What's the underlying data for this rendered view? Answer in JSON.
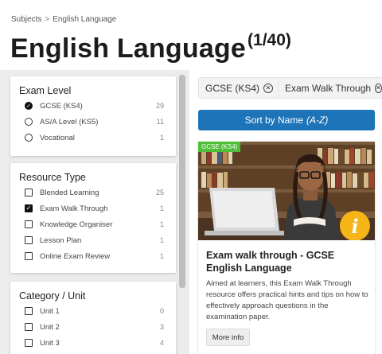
{
  "breadcrumb": {
    "root": "Subjects",
    "separator": ">",
    "current": "English Language"
  },
  "page": {
    "title": "English Language",
    "count": "(1/40)"
  },
  "filters": {
    "exam_level": {
      "title": "Exam Level",
      "options": [
        {
          "label": "GCSE (KS4)",
          "count": "29",
          "checked": true
        },
        {
          "label": "AS/A Level (KS5)",
          "count": "11",
          "checked": false
        },
        {
          "label": "Vocational",
          "count": "1",
          "checked": false
        }
      ]
    },
    "resource_type": {
      "title": "Resource Type",
      "options": [
        {
          "label": "Blended Learning",
          "count": "25",
          "checked": false
        },
        {
          "label": "Exam Walk Through",
          "count": "1",
          "checked": true
        },
        {
          "label": "Knowledge Organiser",
          "count": "1",
          "checked": false
        },
        {
          "label": "Lesson Plan",
          "count": "1",
          "checked": false
        },
        {
          "label": "Online Exam Review",
          "count": "1",
          "checked": false
        }
      ]
    },
    "category": {
      "title": "Category / Unit",
      "options": [
        {
          "label": "Unit 1",
          "count": "0",
          "checked": false
        },
        {
          "label": "Unit 2",
          "count": "3",
          "checked": false
        },
        {
          "label": "Unit 3",
          "count": "4",
          "checked": false
        }
      ]
    }
  },
  "chips": [
    {
      "label": "GCSE (KS4)"
    },
    {
      "label": "Exam Walk Through"
    }
  ],
  "sort": {
    "label": "Sort by Name",
    "order": "(A-Z)"
  },
  "card": {
    "tag": "GCSE (KS4)",
    "title": "Exam walk through - GCSE English Language",
    "description": "Aimed at learners, this Exam Walk Through resource offers practical hints and tips on how to effectively approach questions in the examination paper.",
    "button": "More info",
    "badge": "i"
  },
  "colors": {
    "accent": "#1d74b8",
    "tag_green": "#4fbf3a",
    "badge_yellow": "#f5b418"
  }
}
